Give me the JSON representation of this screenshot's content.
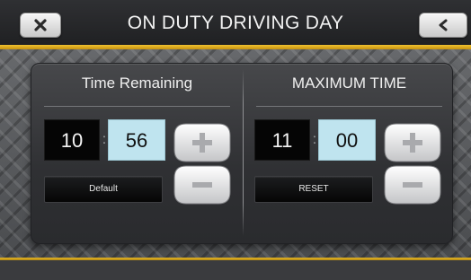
{
  "header": {
    "title": "ON DUTY DRIVING DAY",
    "close_icon": "close-icon",
    "back_icon": "chevron-left-icon",
    "accent_color": "#e8b820"
  },
  "time_remaining": {
    "title": "Time Remaining",
    "hours": "10",
    "separator": ":",
    "minutes": "56",
    "increment_icon": "plus-icon",
    "decrement_icon": "minus-icon",
    "action_label": "Default"
  },
  "maximum_time": {
    "title": "MAXIMUM TIME",
    "hours": "11",
    "separator": ":",
    "minutes": "00",
    "increment_icon": "plus-icon",
    "decrement_icon": "minus-icon",
    "action_label": "RESET"
  }
}
